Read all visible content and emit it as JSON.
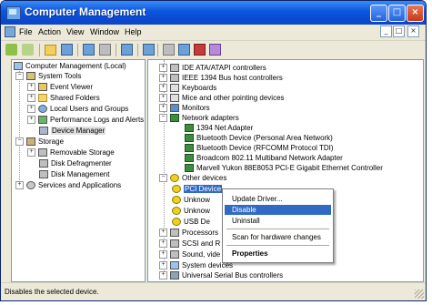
{
  "window": {
    "title": "Computer Management",
    "minimize": "_",
    "maximize": "□",
    "close": "×"
  },
  "menu": {
    "items": [
      "File",
      "Action",
      "View",
      "Window",
      "Help"
    ],
    "mdi": [
      "_",
      "□",
      "×"
    ]
  },
  "left_tree": [
    {
      "label": "Computer Management (Local)",
      "expander": "",
      "icon": "computer-icon"
    },
    {
      "label": "System Tools",
      "expander": "−",
      "icon": "tools-icon"
    },
    {
      "label": "Event Viewer",
      "expander": "+",
      "icon": "event-viewer-icon"
    },
    {
      "label": "Shared Folders",
      "expander": "+",
      "icon": "folder-icon"
    },
    {
      "label": "Local Users and Groups",
      "expander": "+",
      "icon": "users-icon"
    },
    {
      "label": "Performance Logs and Alerts",
      "expander": "+",
      "icon": "performance-icon"
    },
    {
      "label": "Device Manager",
      "expander": "",
      "icon": "device-manager-icon",
      "selected": true
    },
    {
      "label": "Storage",
      "expander": "−",
      "icon": "storage-icon"
    },
    {
      "label": "Removable Storage",
      "expander": "+",
      "icon": "removable-storage-icon"
    },
    {
      "label": "Disk Defragmenter",
      "expander": "",
      "icon": "defrag-icon"
    },
    {
      "label": "Disk Management",
      "expander": "",
      "icon": "disk-icon"
    },
    {
      "label": "Services and Applications",
      "expander": "+",
      "icon": "services-icon"
    }
  ],
  "right_tree": [
    {
      "label": "IDE ATA/ATAPI controllers",
      "expander": "+",
      "icon": "ide-icon"
    },
    {
      "label": "IEEE 1394 Bus host controllers",
      "expander": "+",
      "icon": "ieee1394-icon"
    },
    {
      "label": "Keyboards",
      "expander": "+",
      "icon": "keyboard-icon"
    },
    {
      "label": "Mice and other pointing devices",
      "expander": "+",
      "icon": "mouse-icon"
    },
    {
      "label": "Monitors",
      "expander": "+",
      "icon": "monitor-icon"
    },
    {
      "label": "Network adapters",
      "expander": "−",
      "icon": "network-icon"
    },
    {
      "label": "1394 Net Adapter",
      "expander": "",
      "icon": "net-adapter-icon"
    },
    {
      "label": "Bluetooth Device (Personal Area Network)",
      "expander": "",
      "icon": "net-adapter-icon"
    },
    {
      "label": "Bluetooth Device (RFCOMM Protocol TDI)",
      "expander": "",
      "icon": "net-adapter-icon"
    },
    {
      "label": "Broadcom 802.11 Multiband Network Adapter",
      "expander": "",
      "icon": "net-adapter-icon"
    },
    {
      "label": "Marvell Yukon 88E8053 PCI-E Gigabit Ethernet Controller",
      "expander": "",
      "icon": "net-adapter-icon"
    },
    {
      "label": "Other devices",
      "expander": "−",
      "icon": "question-icon"
    },
    {
      "label": "PCI Device",
      "expander": "",
      "icon": "unknown-device-icon",
      "selected": true
    },
    {
      "label": "Unknow",
      "expander": "",
      "icon": "unknown-device-icon"
    },
    {
      "label": "Unknow",
      "expander": "",
      "icon": "unknown-device-icon"
    },
    {
      "label": "USB De",
      "expander": "",
      "icon": "unknown-device-icon"
    },
    {
      "label": "Processors",
      "expander": "+",
      "icon": "processor-icon"
    },
    {
      "label": "SCSI and R",
      "expander": "+",
      "icon": "scsi-icon"
    },
    {
      "label": "Sound, vide",
      "expander": "+",
      "icon": "sound-icon"
    },
    {
      "label": "System devices",
      "expander": "+",
      "icon": "system-devices-icon"
    },
    {
      "label": "Universal Serial Bus controllers",
      "expander": "+",
      "icon": "usb-icon"
    }
  ],
  "context_menu": {
    "update_driver": "Update Driver...",
    "disable": "Disable",
    "uninstall": "Uninstall",
    "scan": "Scan for hardware changes",
    "properties": "Properties"
  },
  "status": {
    "text": "Disables the selected device."
  }
}
